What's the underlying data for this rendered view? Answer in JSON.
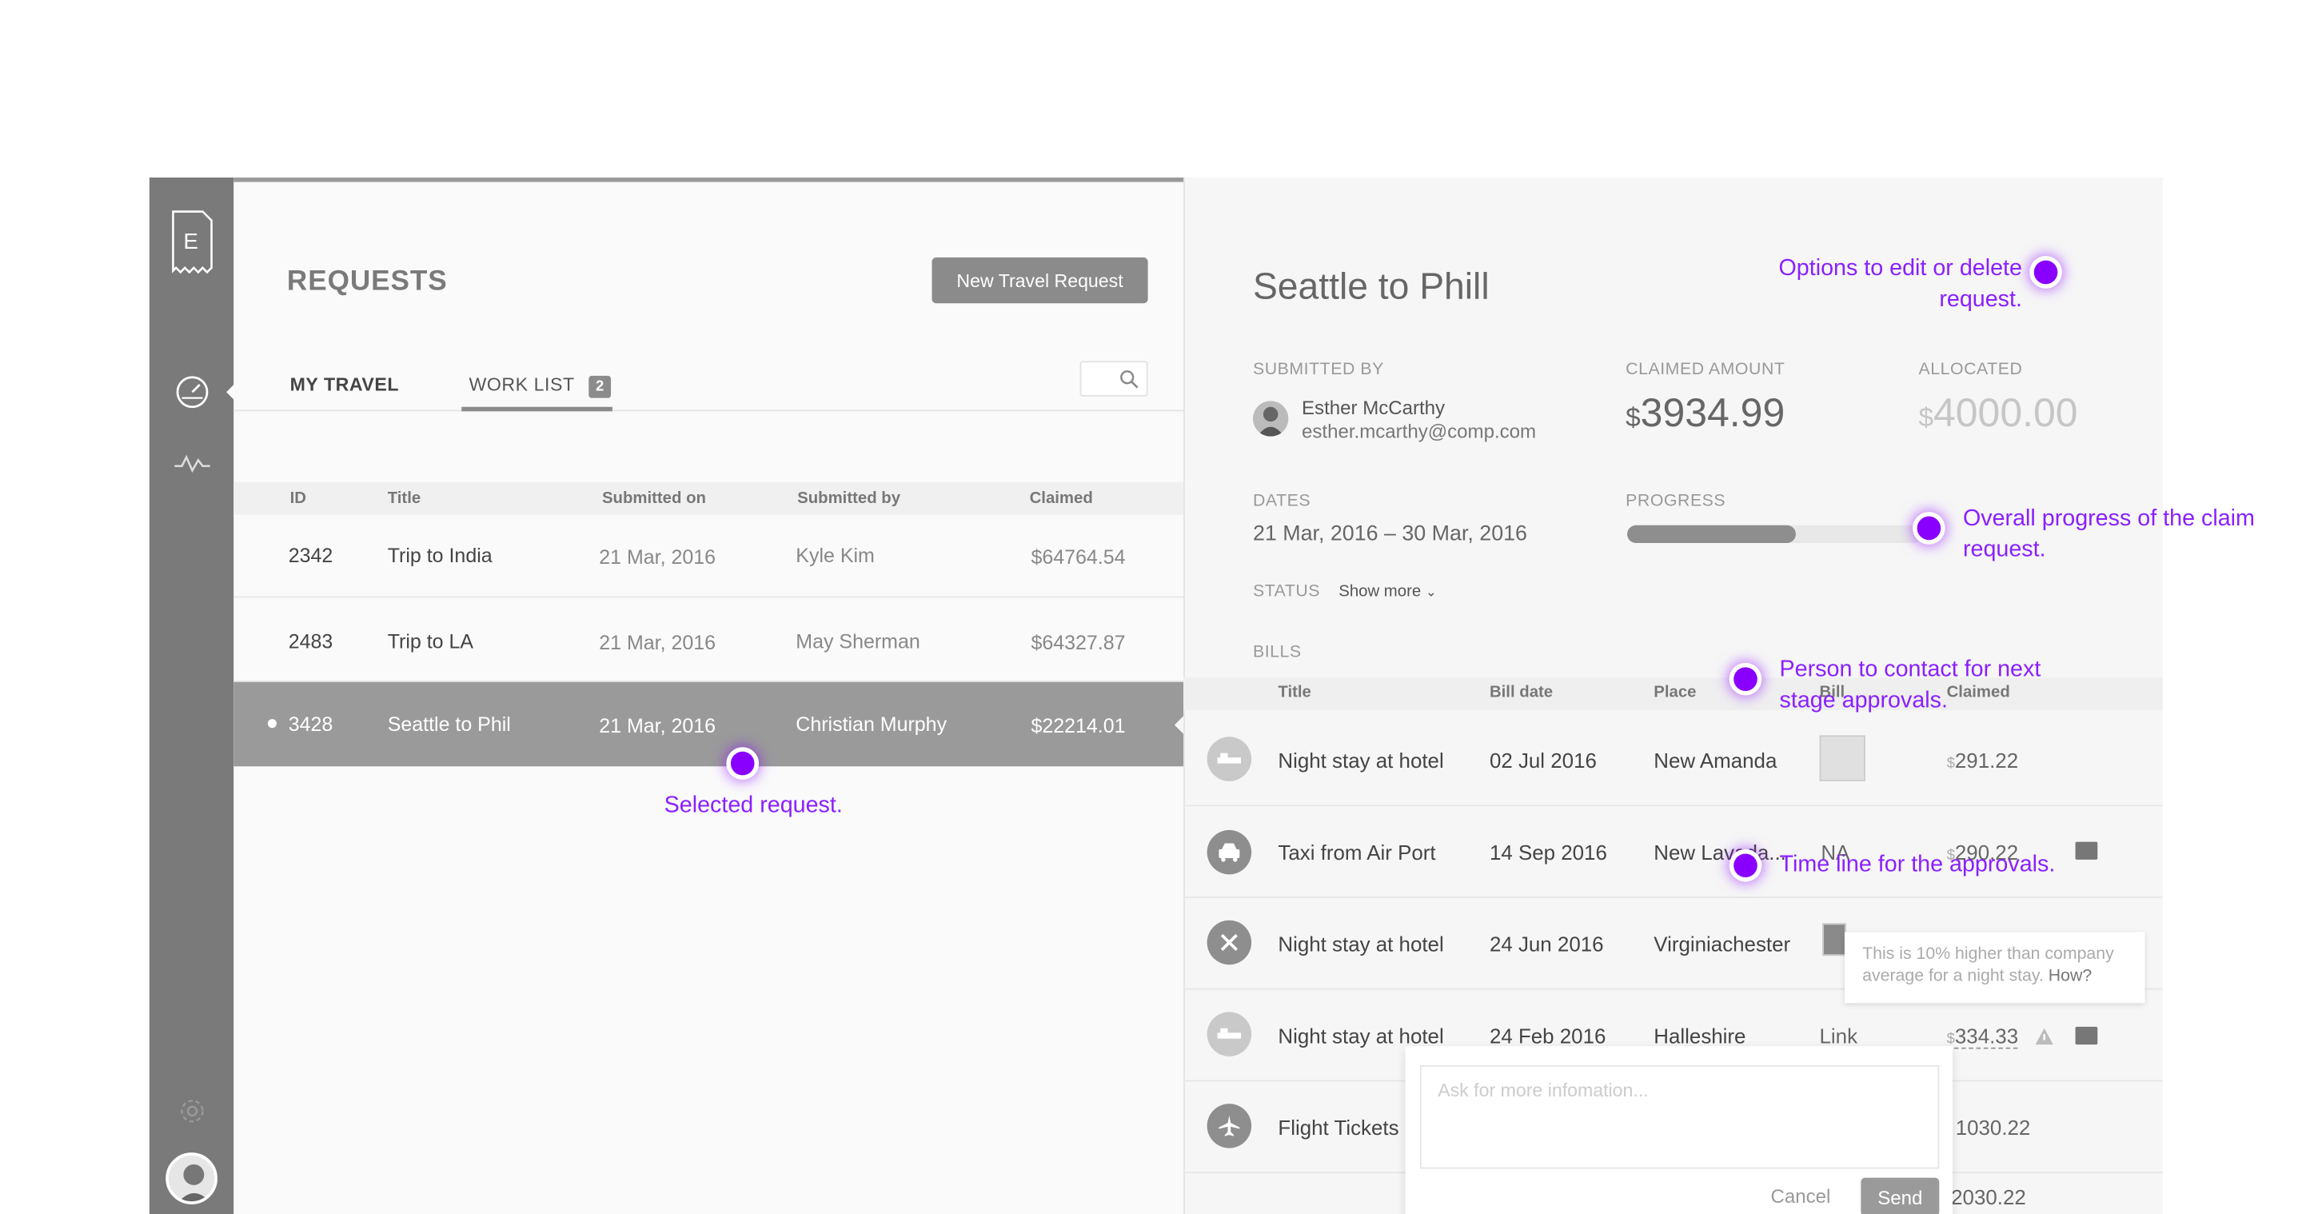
{
  "sidebar": {
    "logo_letter": "E",
    "icons": [
      "document-logo-icon",
      "dashboard-gauge-icon",
      "activity-pulse-icon",
      "settings-gear-icon"
    ]
  },
  "requests": {
    "title": "REQUESTS",
    "new_button": "New Travel Request",
    "tabs": {
      "my_travel": "MY TRAVEL",
      "work_list": "WORK LIST",
      "work_list_count": "2"
    },
    "columns": [
      "ID",
      "Title",
      "Submitted on",
      "Submitted by",
      "Claimed"
    ],
    "rows": [
      {
        "id": "2342",
        "title": "Trip to India",
        "submitted_on": "21 Mar, 2016",
        "submitted_by": "Kyle Kim",
        "claimed": "$64764.54"
      },
      {
        "id": "2483",
        "title": "Trip to LA",
        "submitted_on": "21 Mar, 2016",
        "submitted_by": "May Sherman",
        "claimed": "$64327.87"
      },
      {
        "id": "3428",
        "title": "Seattle to Phil",
        "submitted_on": "21 Mar, 2016",
        "submitted_by": "Christian Murphy",
        "claimed": "$22214.01"
      }
    ]
  },
  "detail": {
    "title": "Seattle to Phill",
    "submitted_by_label": "SUBMITTED BY",
    "submitter_name": "Esther McCarthy",
    "submitter_email": "esther.mcarthy@comp.com",
    "claimed_label": "CLAIMED AMOUNT",
    "claimed_currency": "$",
    "claimed_value": "3934.99",
    "allocated_label": "ALLOCATED",
    "allocated_currency": "$",
    "allocated_value": "4000.00",
    "dates_label": "DATES",
    "dates_value": "21 Mar, 2016 – 30 Mar, 2016",
    "progress_label": "PROGRESS",
    "progress_fraction": 0.57,
    "status_label": "STATUS",
    "show_more": "Show more",
    "bills_label": "BILLS",
    "bill_columns": [
      "Title",
      "Bill date",
      "Place",
      "Bill",
      "Claimed"
    ],
    "bills": [
      {
        "icon": "hotel-bed-icon",
        "title": "Night stay at hotel",
        "date": "02 Jul 2016",
        "place": "New Amanda",
        "bill": "",
        "currency": "$",
        "claimed": "291.22"
      },
      {
        "icon": "taxi-icon",
        "title": "Taxi from Air Port",
        "date": "14 Sep 2016",
        "place": "New Lavada...",
        "bill": "NA",
        "currency": "$",
        "claimed": "290.22"
      },
      {
        "icon": "restaurant-icon",
        "title": "Night stay at hotel",
        "date": "24 Jun 2016",
        "place": "Virginiachester",
        "bill": "",
        "currency": "$",
        "claimed": ""
      },
      {
        "icon": "hotel-bed-icon",
        "title": "Night stay at hotel",
        "date": "24 Feb 2016",
        "place": "Halleshire",
        "bill": "Link",
        "currency": "$",
        "claimed": "334.33"
      },
      {
        "icon": "airplane-icon",
        "title": "Flight Tickets",
        "date": "",
        "place": "",
        "bill": "",
        "currency": "",
        "claimed": "1030.22"
      },
      {
        "icon": "",
        "title": "",
        "date": "",
        "place": "",
        "bill": "",
        "currency": "",
        "claimed": "2030.22"
      }
    ],
    "tooltip_text": "This is 10% higher than company average for a night stay.",
    "tooltip_link": "How?",
    "ask_placeholder": "Ask for more infomation...",
    "cancel_label": "Cancel",
    "send_label": "Send"
  },
  "annotations": {
    "edit_delete": "Options to edit or delete request.",
    "progress": "Overall progress of the claim request.",
    "contact": "Person to contact for next stage approvals.",
    "timeline": "Time line for the approvals.",
    "selected": "Selected request."
  },
  "colors": {
    "accent": "#8a00ff",
    "sidebar": "#7a7a7a",
    "selected_row": "#9a9a9a"
  }
}
